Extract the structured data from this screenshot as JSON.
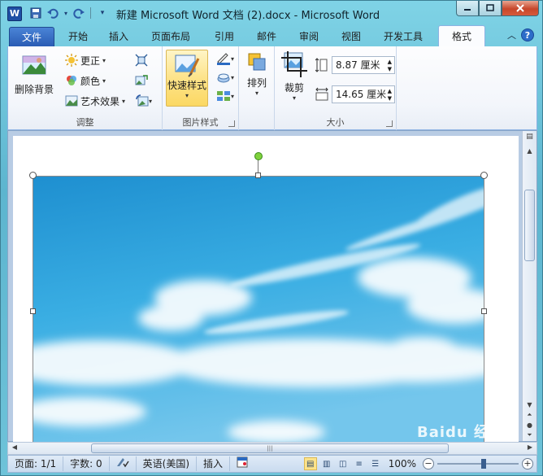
{
  "window": {
    "title": "新建 Microsoft Word 文档 (2).docx  -  Microsoft Word",
    "app_logo": "W"
  },
  "qat": {
    "save_icon": "save-icon",
    "undo_icon": "undo-icon",
    "redo_icon": "redo-icon"
  },
  "tabs": [
    {
      "label": "文件"
    },
    {
      "label": "开始"
    },
    {
      "label": "插入"
    },
    {
      "label": "页面布局"
    },
    {
      "label": "引用"
    },
    {
      "label": "邮件"
    },
    {
      "label": "审阅"
    },
    {
      "label": "视图"
    },
    {
      "label": "开发工具"
    },
    {
      "label": "格式"
    }
  ],
  "ribbon": {
    "adjust": {
      "label": "调整",
      "remove_bg": "删除背景",
      "correct": "更正",
      "color": "颜色",
      "art_effects": "艺术效果"
    },
    "picture_styles": {
      "label": "图片样式",
      "quick_styles": "快速样式"
    },
    "arrange": {
      "label": "排列"
    },
    "size": {
      "label": "大小",
      "crop": "裁剪",
      "height": "8.87 厘米",
      "width": "14.65 厘米"
    }
  },
  "statusbar": {
    "page": "页面: 1/1",
    "words": "字数: 0",
    "language": "英语(美国)",
    "mode": "插入",
    "zoom": "100%"
  },
  "watermark": "Baidu 经验",
  "colors": {
    "file_tab": "#2a5cb4",
    "active_button": "#fde38a",
    "sky": "#2a9fd8"
  }
}
